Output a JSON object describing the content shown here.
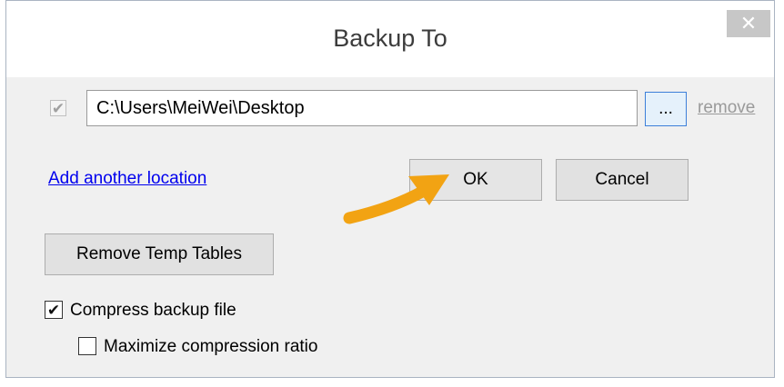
{
  "dialog": {
    "title": "Backup To",
    "close_icon": "close-icon",
    "close_glyph": "✕"
  },
  "location": {
    "checkbox_checked": true,
    "checkbox_glyph": "✔",
    "path_value": "C:\\Users\\MeiWei\\Desktop",
    "browse_label": "...",
    "remove_label": "remove"
  },
  "actions": {
    "add_location_label": "Add another location",
    "ok_label": "OK",
    "cancel_label": "Cancel",
    "remove_temp_label": "Remove Temp Tables"
  },
  "options": {
    "compress_label": "Compress backup file",
    "compress_checked": true,
    "compress_glyph": "✔",
    "maximize_label": "Maximize compression ratio",
    "maximize_checked": false,
    "maximize_glyph": ""
  },
  "colors": {
    "accent_arrow": "#f2a313",
    "link": "#0000ee",
    "dialog_bg": "#f0f0f0"
  },
  "annotation": {
    "arrow_icon": "arrow-icon"
  }
}
